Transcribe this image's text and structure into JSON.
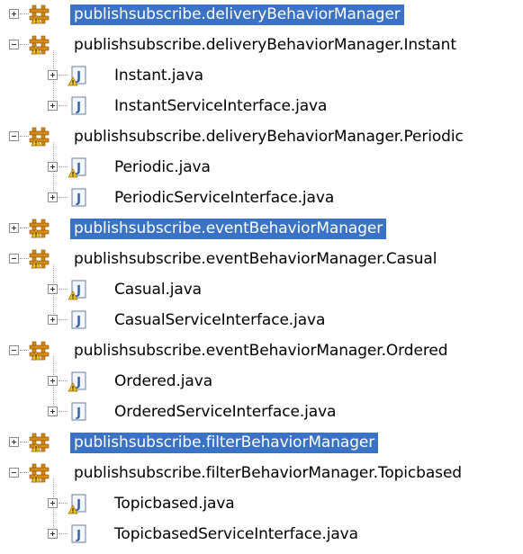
{
  "tree": {
    "rows": [
      {
        "label": "publishsubscribe.deliveryBehaviorManager",
        "type": "package",
        "level": 0,
        "expanded": false,
        "selected": true
      },
      {
        "label": "publishsubscribe.deliveryBehaviorManager.Instant",
        "type": "package",
        "level": 0,
        "expanded": true,
        "selected": false
      },
      {
        "label": "Instant.java",
        "type": "java-warning",
        "level": 1,
        "expanded": false,
        "selected": false
      },
      {
        "label": "InstantServiceInterface.java",
        "type": "java",
        "level": 1,
        "expanded": false,
        "selected": false
      },
      {
        "label": "publishsubscribe.deliveryBehaviorManager.Periodic",
        "type": "package",
        "level": 0,
        "expanded": true,
        "selected": false
      },
      {
        "label": "Periodic.java",
        "type": "java-warning",
        "level": 1,
        "expanded": false,
        "selected": false
      },
      {
        "label": "PeriodicServiceInterface.java",
        "type": "java",
        "level": 1,
        "expanded": false,
        "selected": false
      },
      {
        "label": "publishsubscribe.eventBehaviorManager",
        "type": "package",
        "level": 0,
        "expanded": false,
        "selected": true
      },
      {
        "label": "publishsubscribe.eventBehaviorManager.Casual",
        "type": "package",
        "level": 0,
        "expanded": true,
        "selected": false
      },
      {
        "label": "Casual.java",
        "type": "java-warning",
        "level": 1,
        "expanded": false,
        "selected": false
      },
      {
        "label": "CasualServiceInterface.java",
        "type": "java",
        "level": 1,
        "expanded": false,
        "selected": false
      },
      {
        "label": "publishsubscribe.eventBehaviorManager.Ordered",
        "type": "package",
        "level": 0,
        "expanded": true,
        "selected": false
      },
      {
        "label": "Ordered.java",
        "type": "java-warning",
        "level": 1,
        "expanded": false,
        "selected": false
      },
      {
        "label": "OrderedServiceInterface.java",
        "type": "java",
        "level": 1,
        "expanded": false,
        "selected": false
      },
      {
        "label": "publishsubscribe.filterBehaviorManager",
        "type": "package",
        "level": 0,
        "expanded": false,
        "selected": true
      },
      {
        "label": "publishsubscribe.filterBehaviorManager.Topicbased",
        "type": "package",
        "level": 0,
        "expanded": true,
        "selected": false
      },
      {
        "label": "Topicbased.java",
        "type": "java-warning",
        "level": 1,
        "expanded": false,
        "selected": false
      },
      {
        "label": "TopicbasedServiceInterface.java",
        "type": "java",
        "level": 1,
        "expanded": false,
        "selected": false
      }
    ]
  },
  "icons": {
    "package": "package-warning-icon",
    "java-warning": "java-file-warning-icon",
    "java": "java-file-icon"
  },
  "colors": {
    "selection": "#3a72c6",
    "package_icon": "#d58b1a",
    "java_icon": "#2e5fb0",
    "warning": "#f2c21c"
  }
}
